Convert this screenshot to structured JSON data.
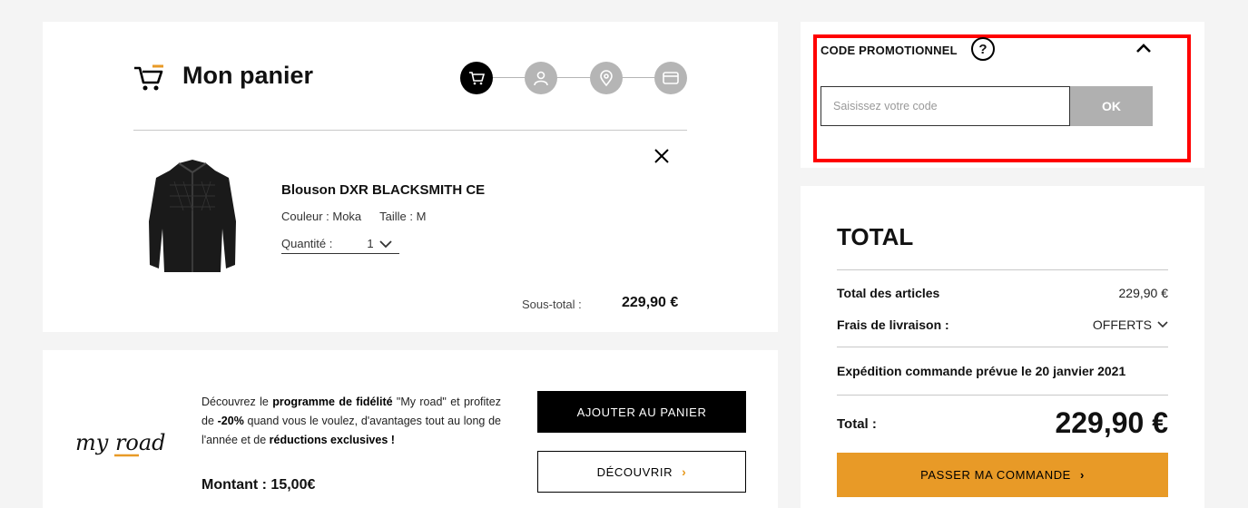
{
  "cart": {
    "title": "Mon panier",
    "steps": [
      {
        "icon": "cart-icon",
        "active": true
      },
      {
        "icon": "user-icon",
        "active": false
      },
      {
        "icon": "location-pin-icon",
        "active": false
      },
      {
        "icon": "credit-card-icon",
        "active": false
      }
    ],
    "item": {
      "name": "Blouson DXR BLACKSMITH CE",
      "color_label": "Couleur : Moka",
      "size_label": "Taille : M",
      "quantity_label": "Quantité :",
      "quantity_value": "1"
    },
    "subtotal_label": "Sous-total :",
    "subtotal_value": "229,90 €"
  },
  "loyalty": {
    "logo_text": "my road",
    "text_1": "Découvrez le ",
    "text_bold_1": "programme de fidélité",
    "text_2": " \"My road\" et profitez de ",
    "text_bold_2": "-20%",
    "text_3": " quand vous le voulez, d'avantages tout au long de l'année et de ",
    "text_bold_3": "réductions exclusives !",
    "amount": "Montant : 15,00€",
    "add_button": "AJOUTER AU PANIER",
    "discover_button": "DÉCOUVRIR"
  },
  "promo": {
    "title": "CODE PROMOTIONNEL",
    "help": "?",
    "placeholder": "Saisissez votre code",
    "ok_button": "OK"
  },
  "total": {
    "title": "TOTAL",
    "items_label": "Total des articles",
    "items_value": "229,90 €",
    "shipping_label": "Frais de livraison :",
    "shipping_value": "OFFERTS",
    "expedition": "Expédition commande prévue le 20 janvier 2021",
    "total_label": "Total :",
    "total_value": "229,90 €",
    "order_button": "PASSER MA COMMANDE"
  },
  "colors": {
    "accent": "#e89a27",
    "highlight_border": "#ff0000",
    "step_active": "#000000",
    "step_inactive": "#b5b5b5"
  }
}
